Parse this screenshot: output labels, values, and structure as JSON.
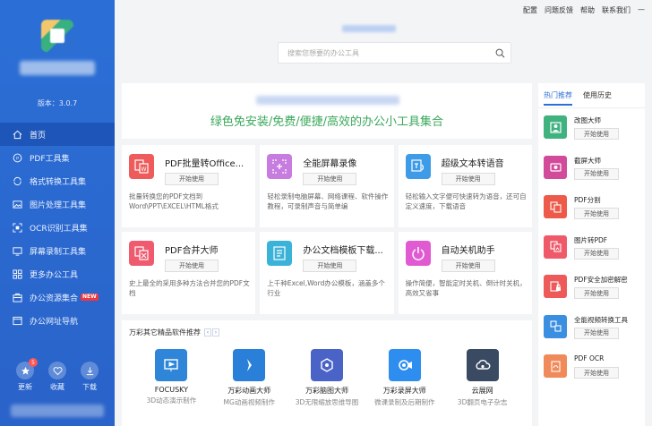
{
  "sidebar": {
    "version": "版本：3.0.7",
    "nav": [
      {
        "label": "首页",
        "icon": "home-icon"
      },
      {
        "label": "PDF工具集",
        "icon": "pdf-icon"
      },
      {
        "label": "格式转换工具集",
        "icon": "convert-icon"
      },
      {
        "label": "图片处理工具集",
        "icon": "image-icon"
      },
      {
        "label": "OCR识别工具集",
        "icon": "ocr-icon"
      },
      {
        "label": "屏幕录制工具集",
        "icon": "screen-icon"
      },
      {
        "label": "更多办公工具",
        "icon": "grid-icon"
      },
      {
        "label": "办公资源集合",
        "icon": "briefcase-icon",
        "badge": "NEW"
      },
      {
        "label": "办公网址导航",
        "icon": "nav-icon"
      }
    ],
    "bottom": [
      {
        "label": "更新",
        "badge": "5"
      },
      {
        "label": "收藏"
      },
      {
        "label": "下载"
      }
    ]
  },
  "topbar": {
    "links": [
      "配置",
      "问题反馈",
      "帮助",
      "联系我们",
      "—"
    ]
  },
  "search": {
    "placeholder": "搜索您想要的办公工具"
  },
  "banner": {
    "slogan": "绿色免安装/免费/便捷/高效的办公小工具集合"
  },
  "tools": [
    {
      "name": "PDF批量转Office...",
      "button": "开始使用",
      "desc": "批量转换您的PDF文档到Word\\PPT\\EXCEL\\HTML格式",
      "color": "#ef5a5a",
      "icon": "pdf-to-office-icon"
    },
    {
      "name": "全能屏幕录像",
      "button": "开始使用",
      "desc": "轻松录制电脑屏幕、网络课程、软件操作教程，可录制声音与简单编",
      "color": "#c77de0",
      "icon": "screen-record-icon"
    },
    {
      "name": "超级文本转语音",
      "button": "开始使用",
      "desc": "轻松输入文字便可快速转为语音，还可自定义速度，下载语音",
      "color": "#3d9be8",
      "icon": "text-to-speech-icon"
    },
    {
      "name": "PDF合并大师",
      "button": "开始使用",
      "desc": "史上最全的采用多种方法合并您的PDF文档",
      "color": "#ef5a6e",
      "icon": "pdf-merge-icon"
    },
    {
      "name": "办公文档模板下载...",
      "button": "开始使用",
      "desc": "上千种Excel,Word办公模板，涵盖多个行业",
      "color": "#3bb3d9",
      "icon": "template-download-icon"
    },
    {
      "name": "自动关机助手",
      "button": "开始使用",
      "desc": "操作简便，智能定时关机、倒计时关机，高效又省事",
      "color": "#e05ad2",
      "icon": "power-icon"
    }
  ],
  "recommend": {
    "title": "万彩其它精品软件推荐",
    "prev": "‹",
    "next": "›",
    "items": [
      {
        "name": "FOCUSKY",
        "desc": "3D动态演示制作",
        "color": "#2f86d9",
        "icon": "focusky-icon"
      },
      {
        "name": "万彩动画大师",
        "desc": "MG动画视频制作",
        "color": "#2a7fd8",
        "icon": "animation-icon"
      },
      {
        "name": "万彩脑图大师",
        "desc": "3D无限缩放思维导图",
        "color": "#4a63c7",
        "icon": "mindmap-icon"
      },
      {
        "name": "万彩录屏大师",
        "desc": "微课录制及后期制作",
        "color": "#2e8ef0",
        "icon": "screen-recorder-icon"
      },
      {
        "name": "云展网",
        "desc": "3D翻页电子杂志",
        "color": "#3b4a63",
        "icon": "cloud-icon"
      }
    ]
  },
  "right_panel": {
    "tabs": [
      "热门推荐",
      "使用历史"
    ],
    "items": [
      {
        "name": "改图大师",
        "button": "开始使用",
        "color": "#3fb27f",
        "icon": "photo-edit-icon"
      },
      {
        "name": "截屏大师",
        "button": "开始使用",
        "color": "#d24a9a",
        "icon": "screenshot-icon"
      },
      {
        "name": "PDF分割",
        "button": "开始使用",
        "color": "#ee5a4a",
        "icon": "pdf-split-icon"
      },
      {
        "name": "图片转PDF",
        "button": "开始使用",
        "color": "#ef5a6a",
        "icon": "image-to-pdf-icon"
      },
      {
        "name": "PDF安全加密解密",
        "button": "开始使用",
        "color": "#ee5a5a",
        "icon": "pdf-lock-icon"
      },
      {
        "name": "全能视频转换工具",
        "button": "开始使用",
        "color": "#3a8fe0",
        "icon": "video-convert-icon"
      },
      {
        "name": "PDF OCR",
        "button": "开始使用",
        "color": "#f08a5a",
        "icon": "pdf-ocr-icon"
      }
    ]
  }
}
